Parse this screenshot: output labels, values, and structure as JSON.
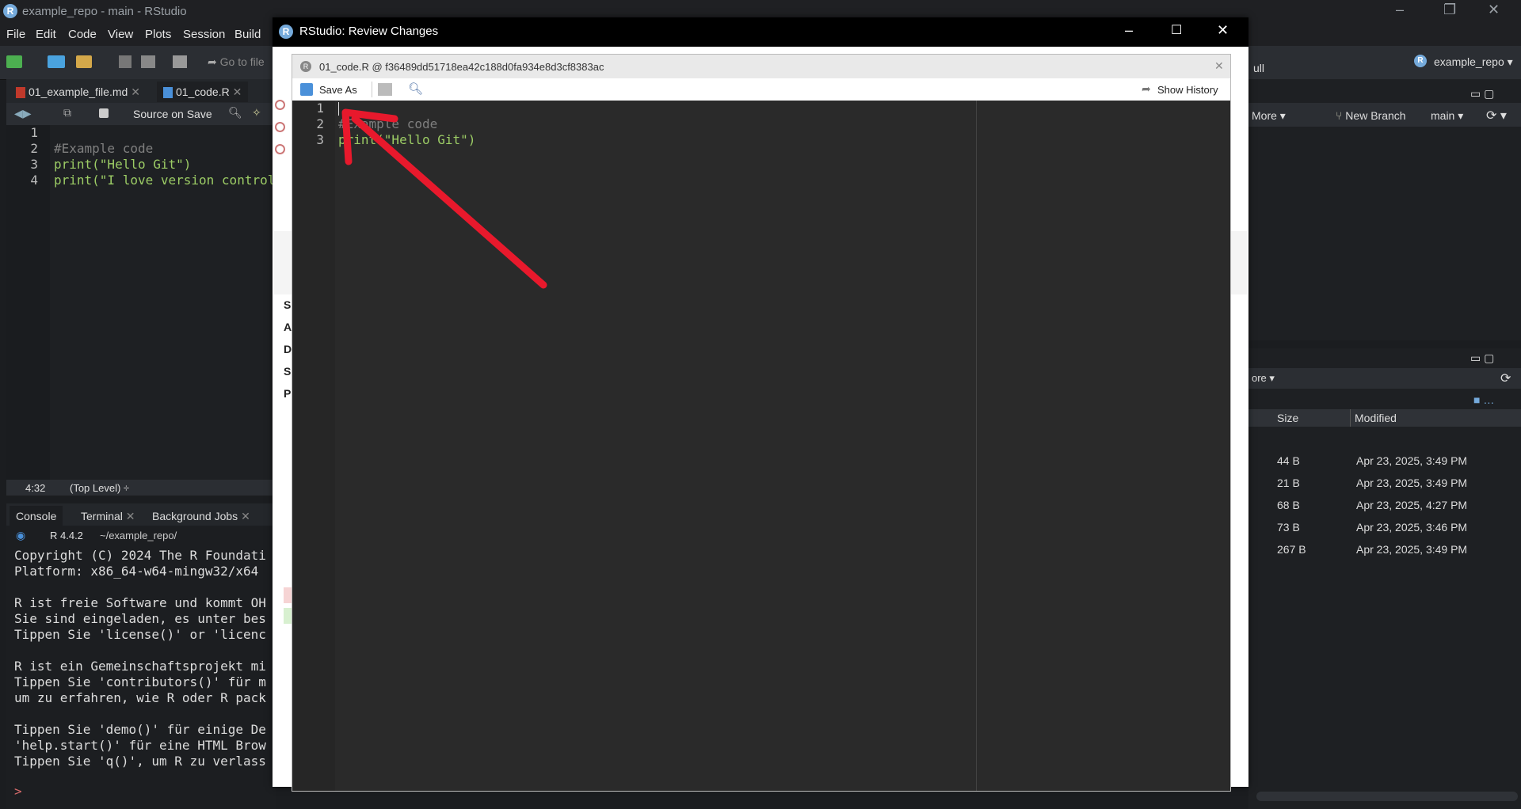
{
  "window": {
    "title": "example_repo - main - RStudio"
  },
  "menu": [
    "File",
    "Edit",
    "Code",
    "View",
    "Plots",
    "Session",
    "Build"
  ],
  "toolbar": {
    "goto_label": "Go to file",
    "project": "example_repo"
  },
  "editor": {
    "tabs": [
      "01_example_file.md",
      "01_code.R"
    ],
    "source_on_save": "Source on Save",
    "lines": [
      {
        "n": "1",
        "text": ""
      },
      {
        "n": "2",
        "text": "#Example code"
      },
      {
        "n": "3",
        "text": "print(\"Hello Git\")"
      },
      {
        "n": "4",
        "text": "print(\"I love version control"
      }
    ],
    "status_pos": "4:32",
    "status_scope": "(Top Level) ÷"
  },
  "console": {
    "tabs": [
      "Console",
      "Terminal",
      "Background Jobs"
    ],
    "r_version": "R 4.4.2",
    "path": "~/example_repo/",
    "lines": [
      "Copyright (C) 2024 The R Foundati",
      "Platform: x86_64-w64-mingw32/x64",
      "",
      "R ist freie Software und kommt OH",
      "Sie sind eingeladen, es unter bes",
      "Tippen Sie 'license()' or 'licenc",
      "",
      "R ist ein Gemeinschaftsprojekt mi",
      "Tippen Sie 'contributors()' für m",
      "um zu erfahren, wie R oder R pack",
      "",
      "Tippen Sie 'demo()' für einige De",
      "'help.start()' für eine HTML Brow",
      "Tippen Sie 'q()', um R zu verlass"
    ],
    "prompt": ">"
  },
  "git_panel": {
    "more": "More",
    "new_branch": "New Branch",
    "branch": "main",
    "pull": "ull"
  },
  "files_panel": {
    "more": "ore",
    "col_size": "Size",
    "col_modified": "Modified",
    "rows": [
      {
        "size": "44 B",
        "modified": "Apr 23, 2025, 3:49 PM"
      },
      {
        "size": "21 B",
        "modified": "Apr 23, 2025, 3:49 PM"
      },
      {
        "size": "68 B",
        "modified": "Apr 23, 2025, 4:27 PM"
      },
      {
        "size": "73 B",
        "modified": "Apr 23, 2025, 3:46 PM"
      },
      {
        "size": "267 B",
        "modified": "Apr 23, 2025, 3:49 PM"
      }
    ]
  },
  "review": {
    "title": "RStudio: Review Changes",
    "side_letters": [
      "S",
      "A",
      "D",
      "S",
      "P"
    ]
  },
  "viewer": {
    "title": "01_code.R @ f36489dd51718ea42c188d0fa934e8d3cf8383ac",
    "save_as": "Save As",
    "show_history": "Show History",
    "lines": [
      {
        "n": "1",
        "text": ""
      },
      {
        "n": "2",
        "text": "#Example code"
      },
      {
        "n": "3",
        "text": "print(\"Hello Git\")"
      }
    ]
  },
  "colors": {
    "accent": "#75aadb",
    "comment": "#7f7f7f",
    "string": "#9ccc65",
    "arrow": "#e8192c"
  }
}
